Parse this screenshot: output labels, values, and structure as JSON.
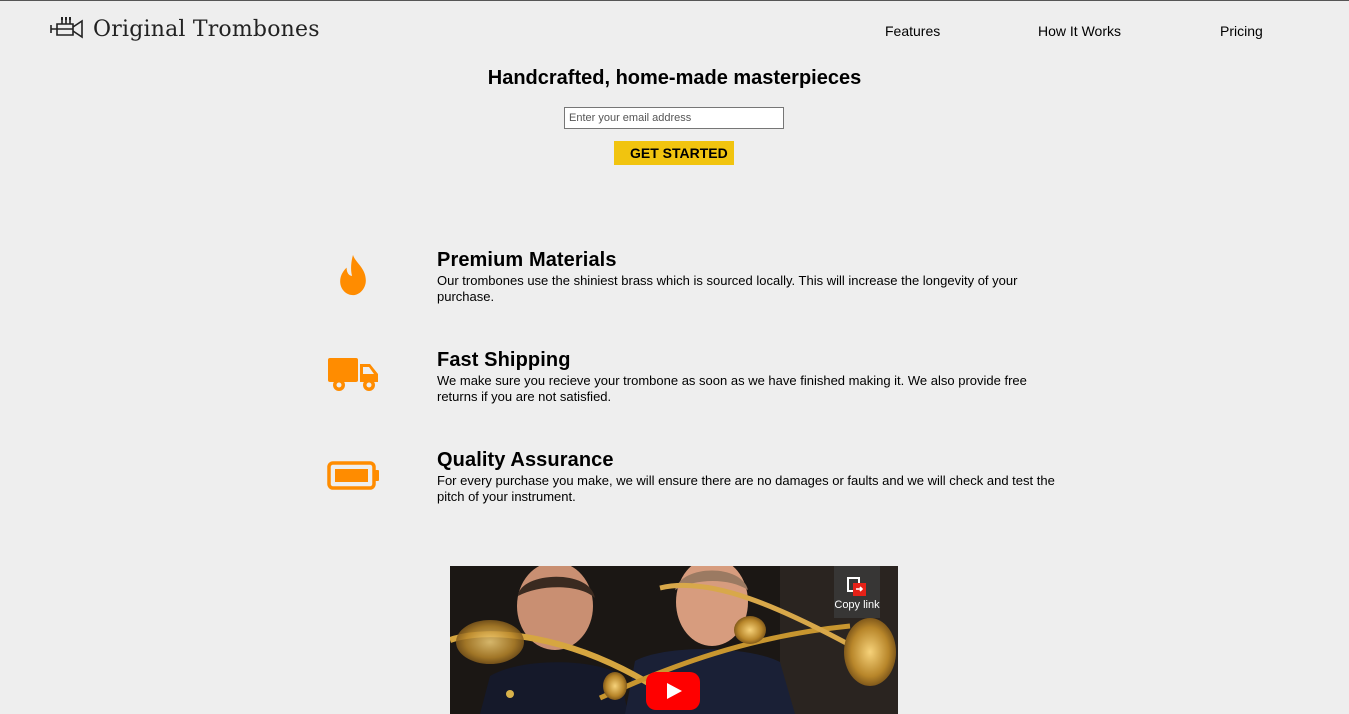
{
  "header": {
    "logo_text": "Original Trombones",
    "logo_icon": "trumpet-icon",
    "nav": [
      {
        "label": "Features"
      },
      {
        "label": "How It Works"
      },
      {
        "label": "Pricing"
      }
    ]
  },
  "hero": {
    "title": "Handcrafted, home-made masterpieces",
    "email_placeholder": "Enter your email address",
    "email_value": "",
    "cta_label": "GET STARTED"
  },
  "features": [
    {
      "icon": "flame-icon",
      "title": "Premium Materials",
      "text": "Our trombones use the shiniest brass which is sourced locally. This will increase the longevity of your purchase."
    },
    {
      "icon": "truck-icon",
      "title": "Fast Shipping",
      "text": "We make sure you recieve your trombone as soon as we have finished making it. We also provide free returns if you are not satisfied."
    },
    {
      "icon": "battery-icon",
      "title": "Quality Assurance",
      "text": "For every purchase you make, we will ensure there are no damages or faults and we will check and test the pitch of your instrument."
    }
  ],
  "video": {
    "copy_link_label": "Copy link",
    "play_icon": "play-icon"
  },
  "colors": {
    "accent": "#f1c40f",
    "icon_orange": "#ff8c00",
    "background": "#eeeeee"
  }
}
